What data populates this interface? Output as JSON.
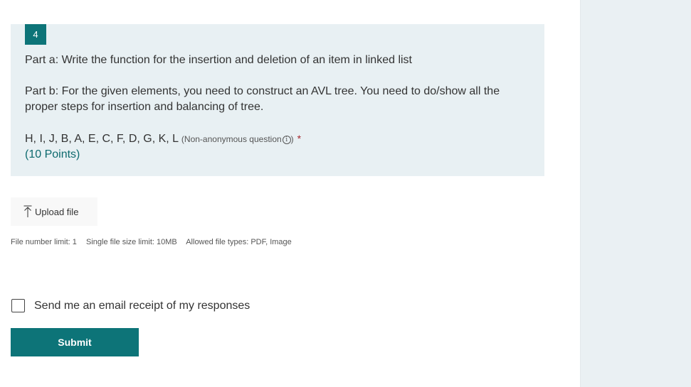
{
  "question": {
    "number": "4",
    "part_a": "Part a: Write the function for the insertion and deletion of an item in linked list",
    "part_b": "Part b: For the given elements, you need to construct an AVL tree. You need to do/show all the proper steps for insertion and balancing of tree.",
    "elements": "H, I, J, B, A, E, C, F, D, G, K, L",
    "note": "(Non-anonymous question",
    "note_close": ")",
    "info_glyph": "i",
    "required": "*",
    "points": "(10 Points)"
  },
  "upload": {
    "label": "Upload file",
    "icon": "upload-icon"
  },
  "file_limits": {
    "number": "File number limit: 1",
    "size": "Single file size limit: 10MB",
    "types": "Allowed file types: PDF, Image"
  },
  "receipt": {
    "label": "Send me an email receipt of my responses"
  },
  "submit": {
    "label": "Submit"
  },
  "colors": {
    "accent": "#0d7478",
    "card_bg": "#e8f0f3",
    "panel_bg": "#eaf0f3",
    "required": "#a4262c"
  }
}
